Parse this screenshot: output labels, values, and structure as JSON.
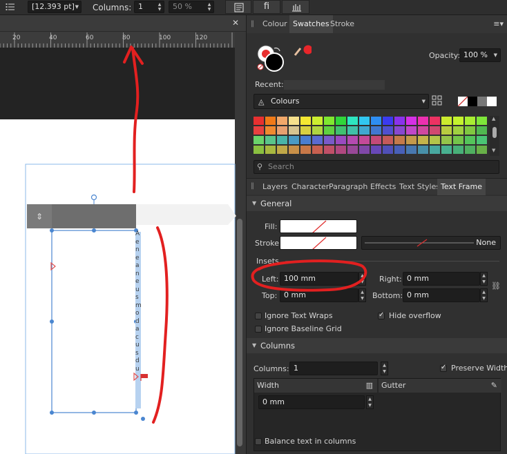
{
  "context_bar": {
    "size_value": "[12.393 pt]",
    "columns_label": "Columns:",
    "columns_value": "1",
    "percent_value": "50 %",
    "ligature_glyph": "ﬁ"
  },
  "ruler": {
    "ticks": [
      "20",
      "40",
      "60",
      "80",
      "100",
      "120"
    ]
  },
  "frame_text": "A e n e a n e u s m o d a c u s d u",
  "panel_top": {
    "tabs": [
      "Colour",
      "Swatches",
      "Stroke"
    ],
    "active_tab": "Swatches",
    "opacity_label": "Opacity:",
    "opacity_value": "100 %",
    "recent_label": "Recent:",
    "palette_name": "Colours",
    "search_placeholder": "Search",
    "colors": {
      "fill_dot": "#e8262a",
      "stroke": "#000000"
    }
  },
  "swatch_rows": [
    [
      "#e83030",
      "#f07a18",
      "#f2a86a",
      "#f7e08c",
      "#f5e832",
      "#cdee30",
      "#7fe830",
      "#30d63a",
      "#2ee6c0",
      "#31c6f0",
      "#2e8ef2",
      "#3b3bf0",
      "#8a32ec",
      "#d530e6",
      "#ec30b0",
      "#ec3262",
      "#cceb2e",
      "#c4f22e",
      "#a8ee32",
      "#7ee63a"
    ],
    [
      "#e84040",
      "#ef8a30",
      "#e8a070",
      "#d8c490",
      "#d8d040",
      "#b0d440",
      "#60d040",
      "#40c070",
      "#40c0a8",
      "#40a8d0",
      "#4078d0",
      "#5050d0",
      "#8848d0",
      "#c048c8",
      "#d048a0",
      "#d04870",
      "#b8cc40",
      "#a0d040",
      "#80c840",
      "#50b850"
    ],
    [
      "#6ad46a",
      "#5ac48a",
      "#4ab4a8",
      "#4a9ac4",
      "#4a7ed0",
      "#5a6ad0",
      "#7a5ac8",
      "#9a4ac0",
      "#b44ab0",
      "#c44a98",
      "#c44a78",
      "#c45a5a",
      "#c47a4a",
      "#c49a4a",
      "#c4b44a",
      "#b4c44a",
      "#94c44a",
      "#74c44a",
      "#54c45a",
      "#4ac474"
    ],
    [
      "#8ac040",
      "#a8b840",
      "#c0a848",
      "#c89048",
      "#c87848",
      "#c86050",
      "#c05068",
      "#b04880",
      "#984898",
      "#8048a8",
      "#6848b8",
      "#5050b8",
      "#4860b8",
      "#4878b0",
      "#4890a8",
      "#48a8a0",
      "#48b090",
      "#48b078",
      "#50b060",
      "#68b048"
    ]
  ],
  "panel_tabs2": [
    "Layers",
    "Character",
    "Paragraph",
    "Effects",
    "Text Styles",
    "Text Frame"
  ],
  "active_tab2": "Text Frame",
  "general": {
    "title": "General",
    "fill_label": "Fill:",
    "stroke_label": "Stroke:",
    "stroke_style": "None",
    "insets_label": "Insets",
    "left_label": "Left:",
    "left_value": "100 mm",
    "right_label": "Right:",
    "right_value": "0 mm",
    "top_label": "Top:",
    "top_value": "0 mm",
    "bottom_label": "Bottom:",
    "bottom_value": "0 mm",
    "ignore_text_wraps": "Ignore Text Wraps",
    "hide_overflow": "Hide overflow",
    "ignore_baseline_grid": "Ignore Baseline Grid"
  },
  "columns": {
    "title": "Columns",
    "columns_label": "Columns:",
    "columns_value": "1",
    "preserve_width": "Preserve Width",
    "width_header": "Width",
    "gutter_header": "Gutter",
    "width_value": "0 mm",
    "balance_text": "Balance text in columns"
  }
}
